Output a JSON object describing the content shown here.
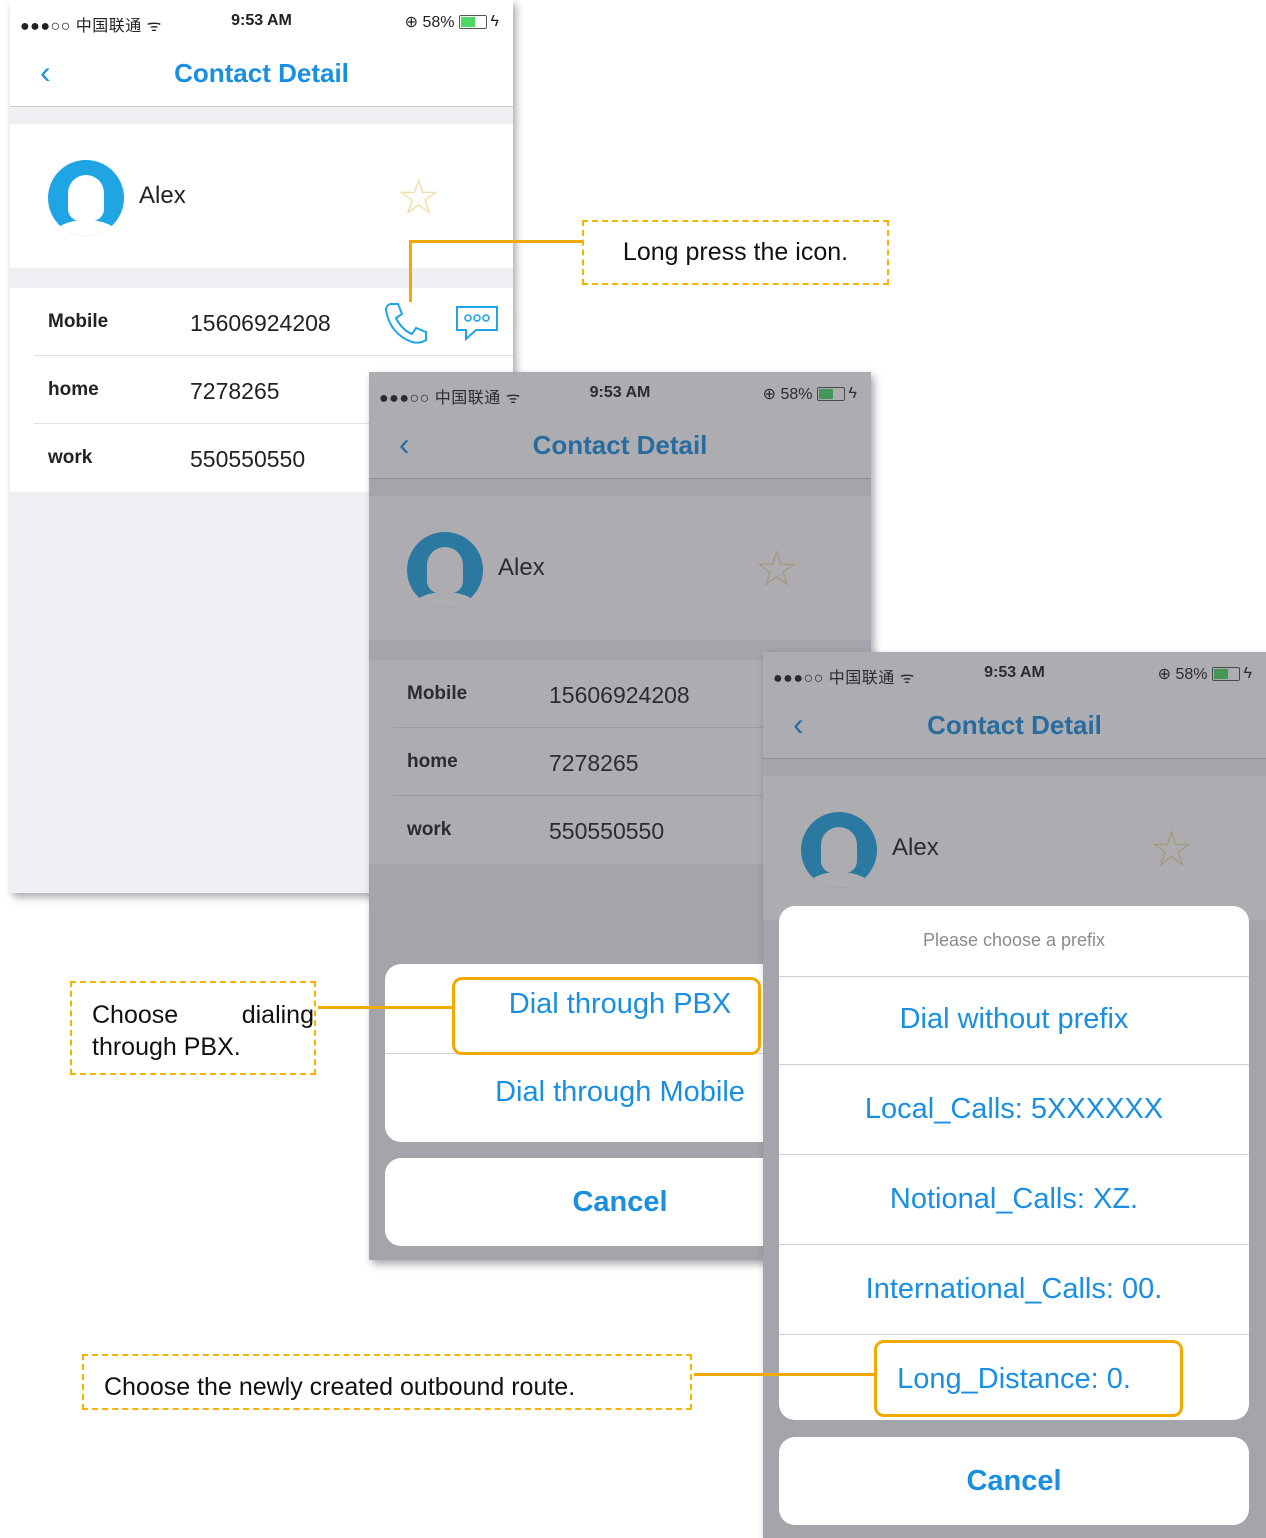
{
  "status": {
    "carrier": "●●●○○ 中国联通 ᯤ",
    "time": "9:53 AM",
    "battery": "⊕ 58%",
    "charge": "ϟ"
  },
  "nav": {
    "back": "‹",
    "title": "Contact Detail"
  },
  "contact": {
    "name": "Alex",
    "rows": [
      {
        "label": "Mobile",
        "number": "15606924208"
      },
      {
        "label": "home",
        "number": "7278265"
      },
      {
        "label": "work",
        "number": "550550550"
      }
    ]
  },
  "icons": {
    "favorite": "star-icon",
    "call": "phone-icon",
    "message": "message-icon",
    "back": "chevron-left-icon"
  },
  "dial_sheet": {
    "pbx": "Dial through PBX",
    "mobile": "Dial through Mobile",
    "cancel": "Cancel"
  },
  "prefix_sheet": {
    "title": "Please choose a prefix",
    "options": [
      "Dial without prefix",
      "Local_Calls: 5XXXXXX",
      "Notional_Calls: XZ.",
      "International_Calls: 00.",
      "Long_Distance: 0."
    ],
    "cancel": "Cancel"
  },
  "callouts": {
    "long_press": "Long press the icon.",
    "choose_pbx": "Choose dialing through PBX.",
    "choose_route": "Choose the newly created outbound route."
  },
  "colors": {
    "accent": "#1a8fe0",
    "highlight": "#f2a900",
    "avatar": "#1fa5e3"
  }
}
